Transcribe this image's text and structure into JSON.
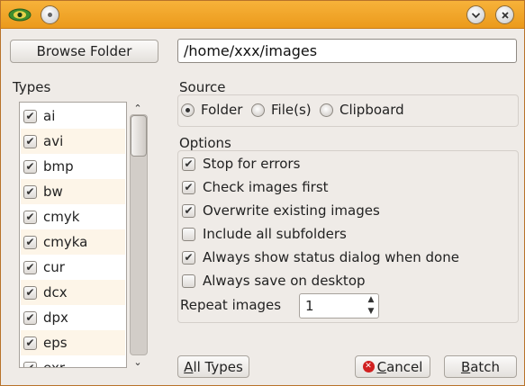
{
  "titlebar": {
    "app_icon": "eye-icon",
    "pin_icon": "pin-icon",
    "minimize_icon": "chevron-down-icon",
    "close_icon": "close-icon"
  },
  "browse_button_label": "Browse Folder",
  "path_value": "/home/xxx/images",
  "types": {
    "label": "Types",
    "items": [
      {
        "label": "ai",
        "checked": true
      },
      {
        "label": "avi",
        "checked": true
      },
      {
        "label": "bmp",
        "checked": true
      },
      {
        "label": "bw",
        "checked": true
      },
      {
        "label": "cmyk",
        "checked": true
      },
      {
        "label": "cmyka",
        "checked": true
      },
      {
        "label": "cur",
        "checked": true
      },
      {
        "label": "dcx",
        "checked": true
      },
      {
        "label": "dpx",
        "checked": true
      },
      {
        "label": "eps",
        "checked": true
      },
      {
        "label": "exr",
        "checked": true
      }
    ]
  },
  "source": {
    "label": "Source",
    "options": [
      "Folder",
      "File(s)",
      "Clipboard"
    ],
    "selected": "Folder"
  },
  "options": {
    "label": "Options",
    "items": [
      {
        "label": "Stop for errors",
        "checked": true
      },
      {
        "label": "Check images first",
        "checked": true
      },
      {
        "label": "Overwrite existing images",
        "checked": true
      },
      {
        "label": "Include all subfolders",
        "checked": false
      },
      {
        "label": "Always show status dialog when done",
        "checked": true
      },
      {
        "label": "Always save on desktop",
        "checked": false
      }
    ],
    "repeat_label": "Repeat images",
    "repeat_value": "1"
  },
  "buttons": {
    "all_types": "All Types",
    "cancel": "Cancel",
    "batch": "Batch"
  },
  "colors": {
    "titlebar": "#f0a429",
    "window_bg": "#efebe7",
    "list_alt_row": "#fdf5e8",
    "cancel_icon": "#d12020"
  }
}
